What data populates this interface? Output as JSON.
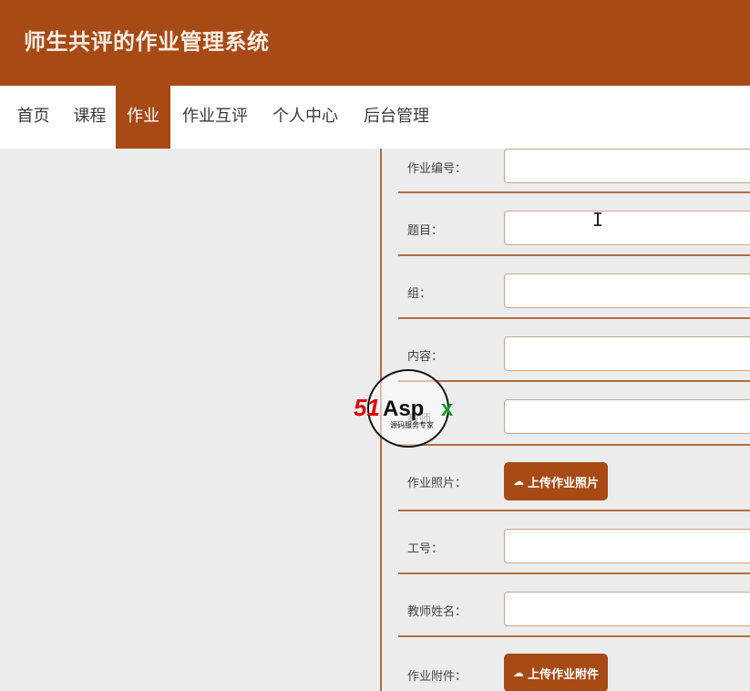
{
  "header": {
    "title": "师生共评的作业管理系统"
  },
  "nav": {
    "items": [
      {
        "label": "首页"
      },
      {
        "label": "课程"
      },
      {
        "label": "作业",
        "active": true
      },
      {
        "label": "作业互评"
      },
      {
        "label": "个人中心"
      },
      {
        "label": "后台管理"
      }
    ]
  },
  "form": {
    "fields": [
      {
        "label": "作业编号：",
        "type": "text",
        "value": ""
      },
      {
        "label": "题目：",
        "type": "text",
        "value": ""
      },
      {
        "label": "组：",
        "type": "text",
        "value": ""
      },
      {
        "label": "内容：",
        "type": "text",
        "value": ""
      },
      {
        "label": "教师",
        "type": "text",
        "value": ""
      },
      {
        "label": "作业照片：",
        "type": "upload",
        "button": "上传作业照片"
      },
      {
        "label": "工号：",
        "type": "text",
        "value": ""
      },
      {
        "label": "教师姓名：",
        "type": "text",
        "value": ""
      },
      {
        "label": "作业附件：",
        "type": "upload",
        "button": "上传作业附件"
      }
    ]
  },
  "watermark": {
    "brand": "51Aspx",
    "subtitle": "源码服务专家"
  },
  "colors": {
    "primary": "#a74a16",
    "nav_bg": "#ffffff",
    "page_bg": "#ececec"
  }
}
